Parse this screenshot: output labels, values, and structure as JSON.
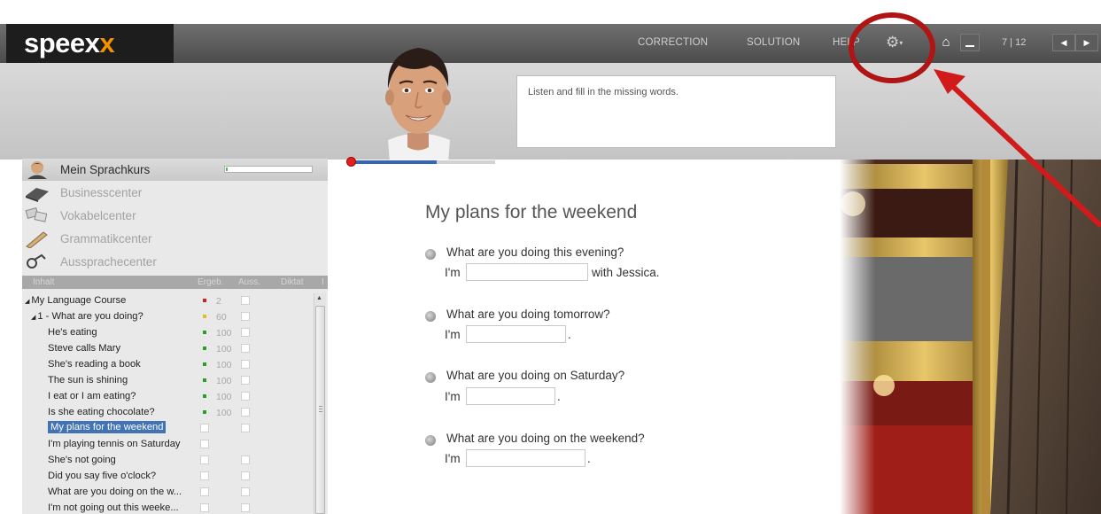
{
  "app": {
    "logo_main": "speex",
    "logo_accent": "x"
  },
  "topnav": {
    "correction": "CORRECTION",
    "solution": "SOLUTION",
    "help": "HELP",
    "settings_icon": "gear-icon",
    "home_icon": "home-icon",
    "minimize_icon": "minimize-icon",
    "page_indicator": "7 | 12",
    "prev_icon": "arrow-left-icon",
    "next_icon": "arrow-right-icon"
  },
  "instruction": "Listen and fill in the missing words.",
  "sidebar": {
    "centers": [
      {
        "label": "Mein Sprachkurs",
        "icon": "course-avatar-icon",
        "active": true
      },
      {
        "label": "Businesscenter",
        "icon": "business-icon",
        "active": false
      },
      {
        "label": "Vokabelcenter",
        "icon": "vocabulary-icon",
        "active": false
      },
      {
        "label": "Grammatikcenter",
        "icon": "grammar-icon",
        "active": false
      },
      {
        "label": "Aussprachecenter",
        "icon": "pronunciation-icon",
        "active": false
      }
    ],
    "course_progress": 0.02,
    "columns": [
      "Inhalt",
      "Ergeb.",
      "Auss.",
      "Diktat",
      "I"
    ],
    "tree": [
      {
        "label": "My Language Course",
        "expander": "◢",
        "level": 0,
        "score_color": "#d22020",
        "score": "2"
      },
      {
        "label": "1 - What are you doing?",
        "expander": "◢",
        "level": 1,
        "score_color": "#e0c020",
        "score": "60"
      },
      {
        "label": "He's eating",
        "level": 2,
        "score_color": "#2aa02a",
        "score": "100"
      },
      {
        "label": "Steve calls Mary",
        "level": 2,
        "score_color": "#2aa02a",
        "score": "100"
      },
      {
        "label": "She's reading a book",
        "level": 2,
        "score_color": "#2aa02a",
        "score": "100"
      },
      {
        "label": "The sun is shining",
        "level": 2,
        "score_color": "#2aa02a",
        "score": "100"
      },
      {
        "label": "I eat or I am eating?",
        "level": 2,
        "score_color": "#2aa02a",
        "score": "100"
      },
      {
        "label": "Is she eating chocolate?",
        "level": 2,
        "score_color": "#2aa02a",
        "score": "100"
      },
      {
        "label": "My plans for the weekend",
        "level": 2,
        "selected": true
      },
      {
        "label": "I'm playing tennis on Saturday",
        "level": 2
      },
      {
        "label": "She's not going",
        "level": 2
      },
      {
        "label": "Did you say five o'clock?",
        "level": 2
      },
      {
        "label": "What are you doing on the w...",
        "level": 2
      },
      {
        "label": "I'm not going out this weeke...",
        "level": 2
      }
    ]
  },
  "exercise": {
    "progress": 0.6,
    "title": "My plans for the weekend",
    "questions": [
      {
        "question": "What are you doing this evening?",
        "prefix": "I'm",
        "value": "",
        "suffix": "with Jessica."
      },
      {
        "question": "What are you doing tomorrow?",
        "prefix": "I'm",
        "value": "",
        "suffix": "."
      },
      {
        "question": "What are you doing on Saturday?",
        "prefix": "I'm",
        "value": "",
        "suffix": "."
      },
      {
        "question": "What are you doing on the weekend?",
        "prefix": "I'm",
        "value": "",
        "suffix": "."
      }
    ]
  },
  "colors": {
    "accent": "#f39200",
    "selection": "#4273b5",
    "annotation": "#b01515"
  }
}
